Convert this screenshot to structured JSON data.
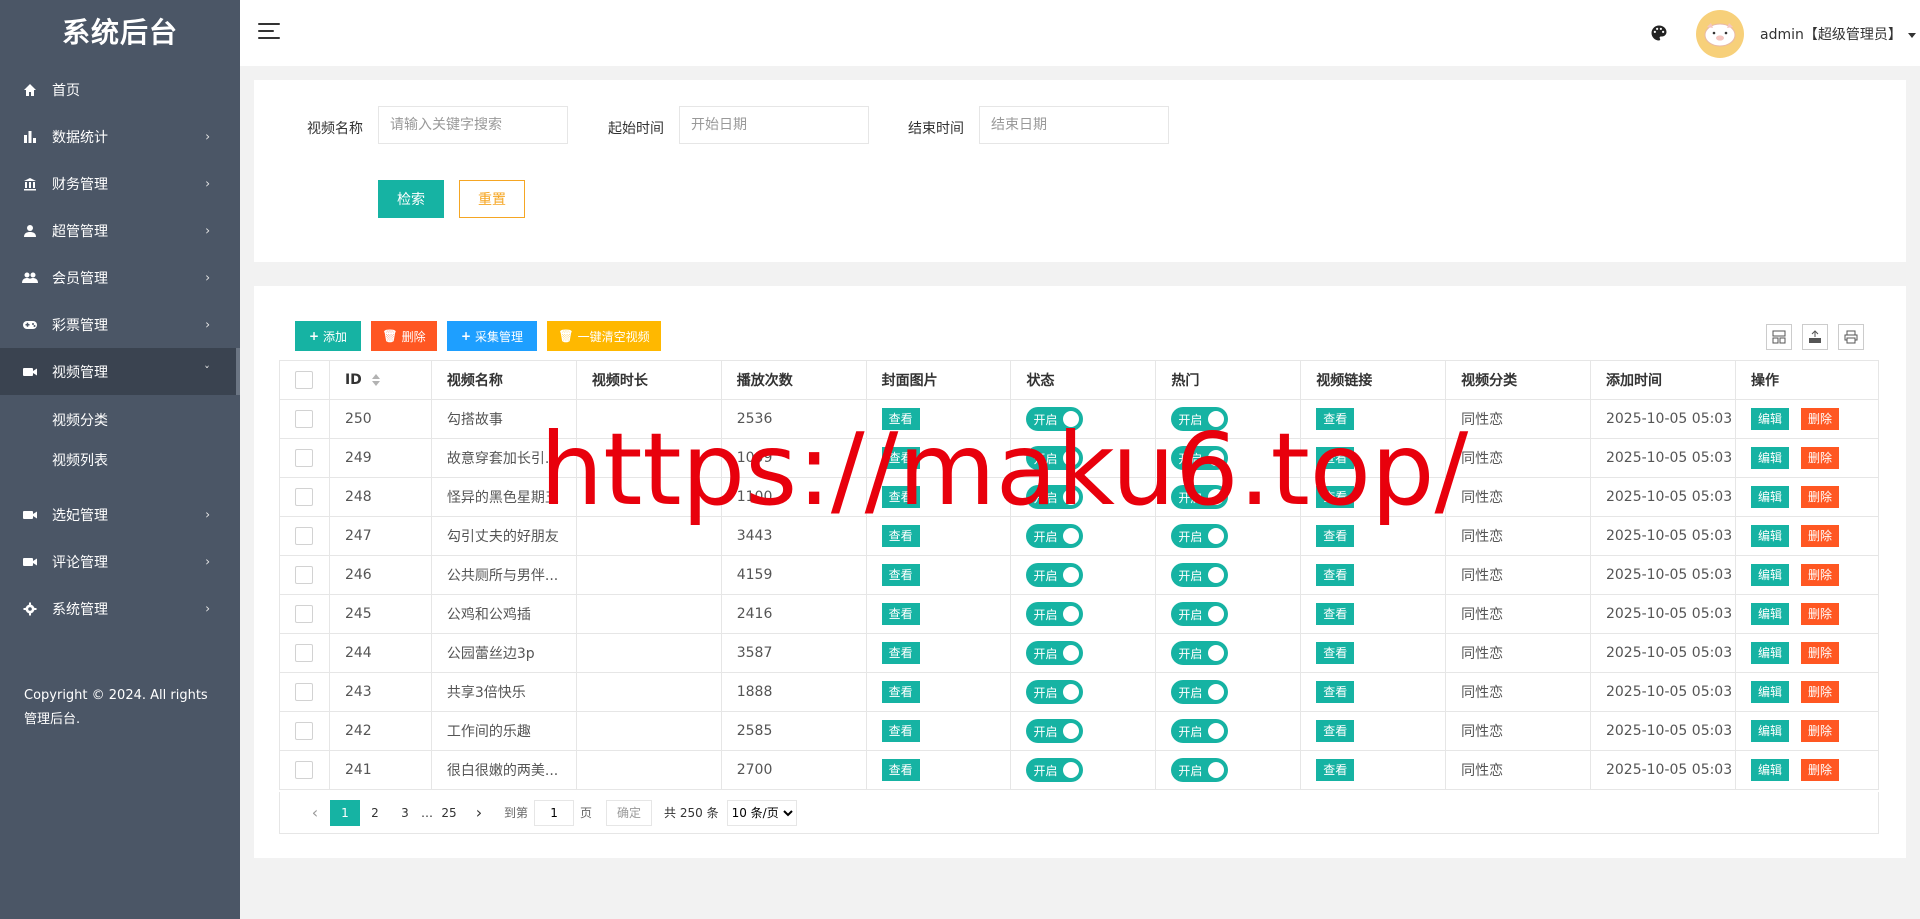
{
  "app_title": "系统后台",
  "sidebar": {
    "items": [
      {
        "label": "首页",
        "icon": "home-icon",
        "arrow": ""
      },
      {
        "label": "数据统计",
        "icon": "bar-chart-icon",
        "arrow": "›"
      },
      {
        "label": "财务管理",
        "icon": "bank-icon",
        "arrow": "›"
      },
      {
        "label": "超管管理",
        "icon": "user-icon",
        "arrow": "›"
      },
      {
        "label": "会员管理",
        "icon": "users-icon",
        "arrow": "›"
      },
      {
        "label": "彩票管理",
        "icon": "gamepad-icon",
        "arrow": "›"
      },
      {
        "label": "视频管理",
        "icon": "video-icon",
        "arrow": "ˇ"
      },
      {
        "label": "选妃管理",
        "icon": "video-icon",
        "arrow": "›"
      },
      {
        "label": "评论管理",
        "icon": "video-icon",
        "arrow": "›"
      },
      {
        "label": "系统管理",
        "icon": "gear-icon",
        "arrow": "›"
      }
    ],
    "sub_items": [
      "视频分类",
      "视频列表"
    ],
    "copyright": "Copyright © 2024. All rights 管理后台."
  },
  "header": {
    "user": "admin【超级管理员】"
  },
  "search": {
    "name_label": "视频名称",
    "name_placeholder": "请输入关键字搜索",
    "start_label": "起始时间",
    "start_placeholder": "开始日期",
    "end_label": "结束时间",
    "end_placeholder": "结束日期",
    "search_btn": "检索",
    "reset_btn": "重置"
  },
  "toolbar": {
    "add": "添加",
    "delete": "删除",
    "collect": "采集管理",
    "clear": "一键清空视频"
  },
  "table": {
    "columns": [
      "ID",
      "视频名称",
      "视频时长",
      "播放次数",
      "封面图片",
      "状态",
      "热门",
      "视频链接",
      "视频分类",
      "添加时间",
      "操作"
    ],
    "view_label": "查看",
    "toggle_on": "开启",
    "edit_label": "编辑",
    "delete_label": "删除",
    "rows": [
      {
        "id": "250",
        "name": "勾搭故事",
        "duration": "",
        "plays": "2536",
        "category": "同性恋",
        "time": "2025-10-05 05:03"
      },
      {
        "id": "249",
        "name": "故意穿套加长引...",
        "duration": "",
        "plays": "1009",
        "category": "同性恋",
        "time": "2025-10-05 05:03"
      },
      {
        "id": "248",
        "name": "怪异的黑色星期五",
        "duration": "",
        "plays": "1100",
        "category": "同性恋",
        "time": "2025-10-05 05:03"
      },
      {
        "id": "247",
        "name": "勾引丈夫的好朋友",
        "duration": "",
        "plays": "3443",
        "category": "同性恋",
        "time": "2025-10-05 05:03"
      },
      {
        "id": "246",
        "name": "公共厕所与男伴...",
        "duration": "",
        "plays": "4159",
        "category": "同性恋",
        "time": "2025-10-05 05:03"
      },
      {
        "id": "245",
        "name": "公鸡和公鸡插",
        "duration": "",
        "plays": "2416",
        "category": "同性恋",
        "time": "2025-10-05 05:03"
      },
      {
        "id": "244",
        "name": "公园蕾丝边3p",
        "duration": "",
        "plays": "3587",
        "category": "同性恋",
        "time": "2025-10-05 05:03"
      },
      {
        "id": "243",
        "name": "共享3倍快乐",
        "duration": "",
        "plays": "1888",
        "category": "同性恋",
        "time": "2025-10-05 05:03"
      },
      {
        "id": "242",
        "name": "工作间的乐趣",
        "duration": "",
        "plays": "2585",
        "category": "同性恋",
        "time": "2025-10-05 05:03"
      },
      {
        "id": "241",
        "name": "很白很嫩的两美...",
        "duration": "",
        "plays": "2700",
        "category": "同性恋",
        "time": "2025-10-05 05:03"
      }
    ]
  },
  "pager": {
    "pages": [
      "1",
      "2",
      "3",
      "…",
      "25"
    ],
    "current": "1",
    "goto_label": "到第",
    "goto_value": "1",
    "page_unit": "页",
    "confirm": "确定",
    "total": "共 250 条",
    "size": "10 条/页"
  },
  "watermark": "https://maku6.top/",
  "colors": {
    "sidebar": "#4b5666",
    "accent": "#16b3a3",
    "danger": "#ff5722",
    "info": "#1e9fff",
    "warning": "#ffb800",
    "reset": "#f5a623",
    "watermark": "#e8000c"
  }
}
